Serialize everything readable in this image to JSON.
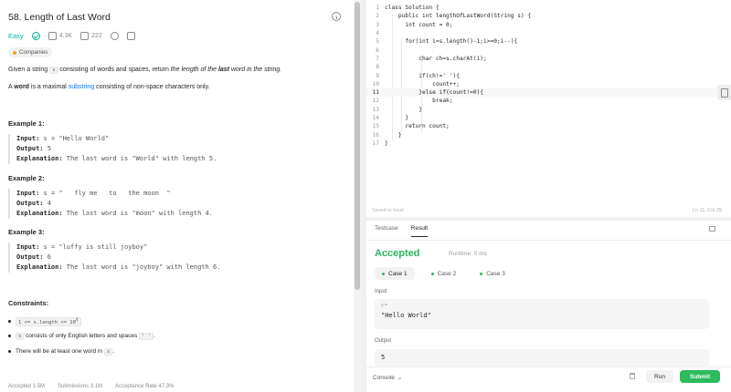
{
  "problem": {
    "title": "58. Length of Last Word",
    "difficulty": "Easy",
    "likes": "4.3K",
    "comments": "222",
    "companies_label": "Companies",
    "desc1_a": "Given a string ",
    "desc1_code": "s",
    "desc1_b": " consisting of words and spaces, return ",
    "desc1_em": "the length of the ",
    "desc1_strong": "last",
    "desc1_em2": " word in the string.",
    "desc2_a": "A ",
    "desc2_strong": "word",
    "desc2_b": " is a maximal ",
    "desc2_link": "substring",
    "desc2_c": " consisting of non-space characters only.",
    "examples": [
      {
        "heading": "Example 1:",
        "input": "s = \"Hello World\"",
        "output": "5",
        "explanation": "The last word is \"World\" with length 5."
      },
      {
        "heading": "Example 2:",
        "input": "s = \"   fly me   to   the moon  \"",
        "output": "4",
        "explanation": "The last word is \"moon\" with length 4."
      },
      {
        "heading": "Example 3:",
        "input": "s = \"luffy is still joyboy\"",
        "output": "6",
        "explanation": "The last word is \"joyboy\" with length 6."
      }
    ],
    "labels": {
      "input": "Input:",
      "output": "Output:",
      "explanation": "Explanation:"
    },
    "constraints_heading": "Constraints:",
    "constraint1_code": "1 <= s.length <= 10",
    "constraint1_sup": "4",
    "constraint2_code": "s",
    "constraint2_text": " consists of only English letters and spaces ",
    "constraint2_code2": "' '",
    "constraint2_end": ".",
    "constraint3_text": "There will be at least one word in ",
    "constraint3_code": "s",
    "constraint3_end": ".",
    "stats": {
      "accepted": "Accepted  1.5M",
      "submissions": "Submissions  3.1M",
      "rate": "Acceptance Rate  47.3%"
    }
  },
  "editor": {
    "lines": [
      {
        "n": "1",
        "t": "class Solution {"
      },
      {
        "n": "2",
        "t": "    public int lengthOfLastWord(String s) {"
      },
      {
        "n": "3",
        "t": "      int count = 0;"
      },
      {
        "n": "4",
        "t": ""
      },
      {
        "n": "5",
        "t": "      for(int i=s.length()-1;i>=0;i--){"
      },
      {
        "n": "6",
        "t": ""
      },
      {
        "n": "7",
        "t": "          char ch=s.charAt(i);"
      },
      {
        "n": "8",
        "t": ""
      },
      {
        "n": "9",
        "t": "          if(ch!=' '){"
      },
      {
        "n": "10",
        "t": "              count++;"
      },
      {
        "n": "11",
        "t": "          }else if(count!=0){"
      },
      {
        "n": "12",
        "t": "              break;"
      },
      {
        "n": "13",
        "t": "          }"
      },
      {
        "n": "14",
        "t": "      }"
      },
      {
        "n": "15",
        "t": "      return count;"
      },
      {
        "n": "16",
        "t": "    }"
      },
      {
        "n": "17",
        "t": "}"
      }
    ],
    "saved": "Saved to local",
    "cursor": "Ln 11, Col 25"
  },
  "result": {
    "tab_testcase": "Testcase",
    "tab_result": "Result",
    "status": "Accepted",
    "runtime": "Runtime: 0 ms",
    "cases": [
      "Case 1",
      "Case 2",
      "Case 3"
    ],
    "input_label": "Input",
    "input_var": "s =",
    "input_value": "\"Hello World\"",
    "output_label": "Output",
    "output_value": "5",
    "console": "Console",
    "run": "Run",
    "submit": "Submit"
  },
  "colors": {
    "accepted": "#2db55d",
    "easy": "#00b8a3",
    "submit_bg": "#2cbb5d",
    "link": "#007aff"
  }
}
